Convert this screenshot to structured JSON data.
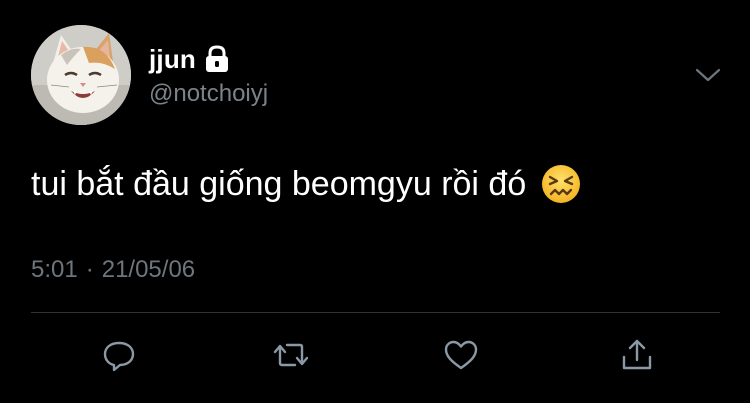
{
  "tweet": {
    "display_name": "jjun",
    "handle": "@notchoiyj",
    "text": "tui bắt đầu giống beomgyu rồi đó",
    "time": "5:01",
    "separator": "·",
    "date": "21/05/06"
  },
  "icons": {
    "lock": "lock-icon",
    "chevron": "chevron-down-icon",
    "emoji": "confounded-face-emoji",
    "reply": "reply-icon",
    "retweet": "retweet-icon",
    "like": "heart-icon",
    "share": "share-icon"
  },
  "colors": {
    "background": "#000000",
    "text": "#ffffff",
    "secondary_text": "#7c8388",
    "divider": "#2f3336",
    "icon": "#8b98a5"
  }
}
